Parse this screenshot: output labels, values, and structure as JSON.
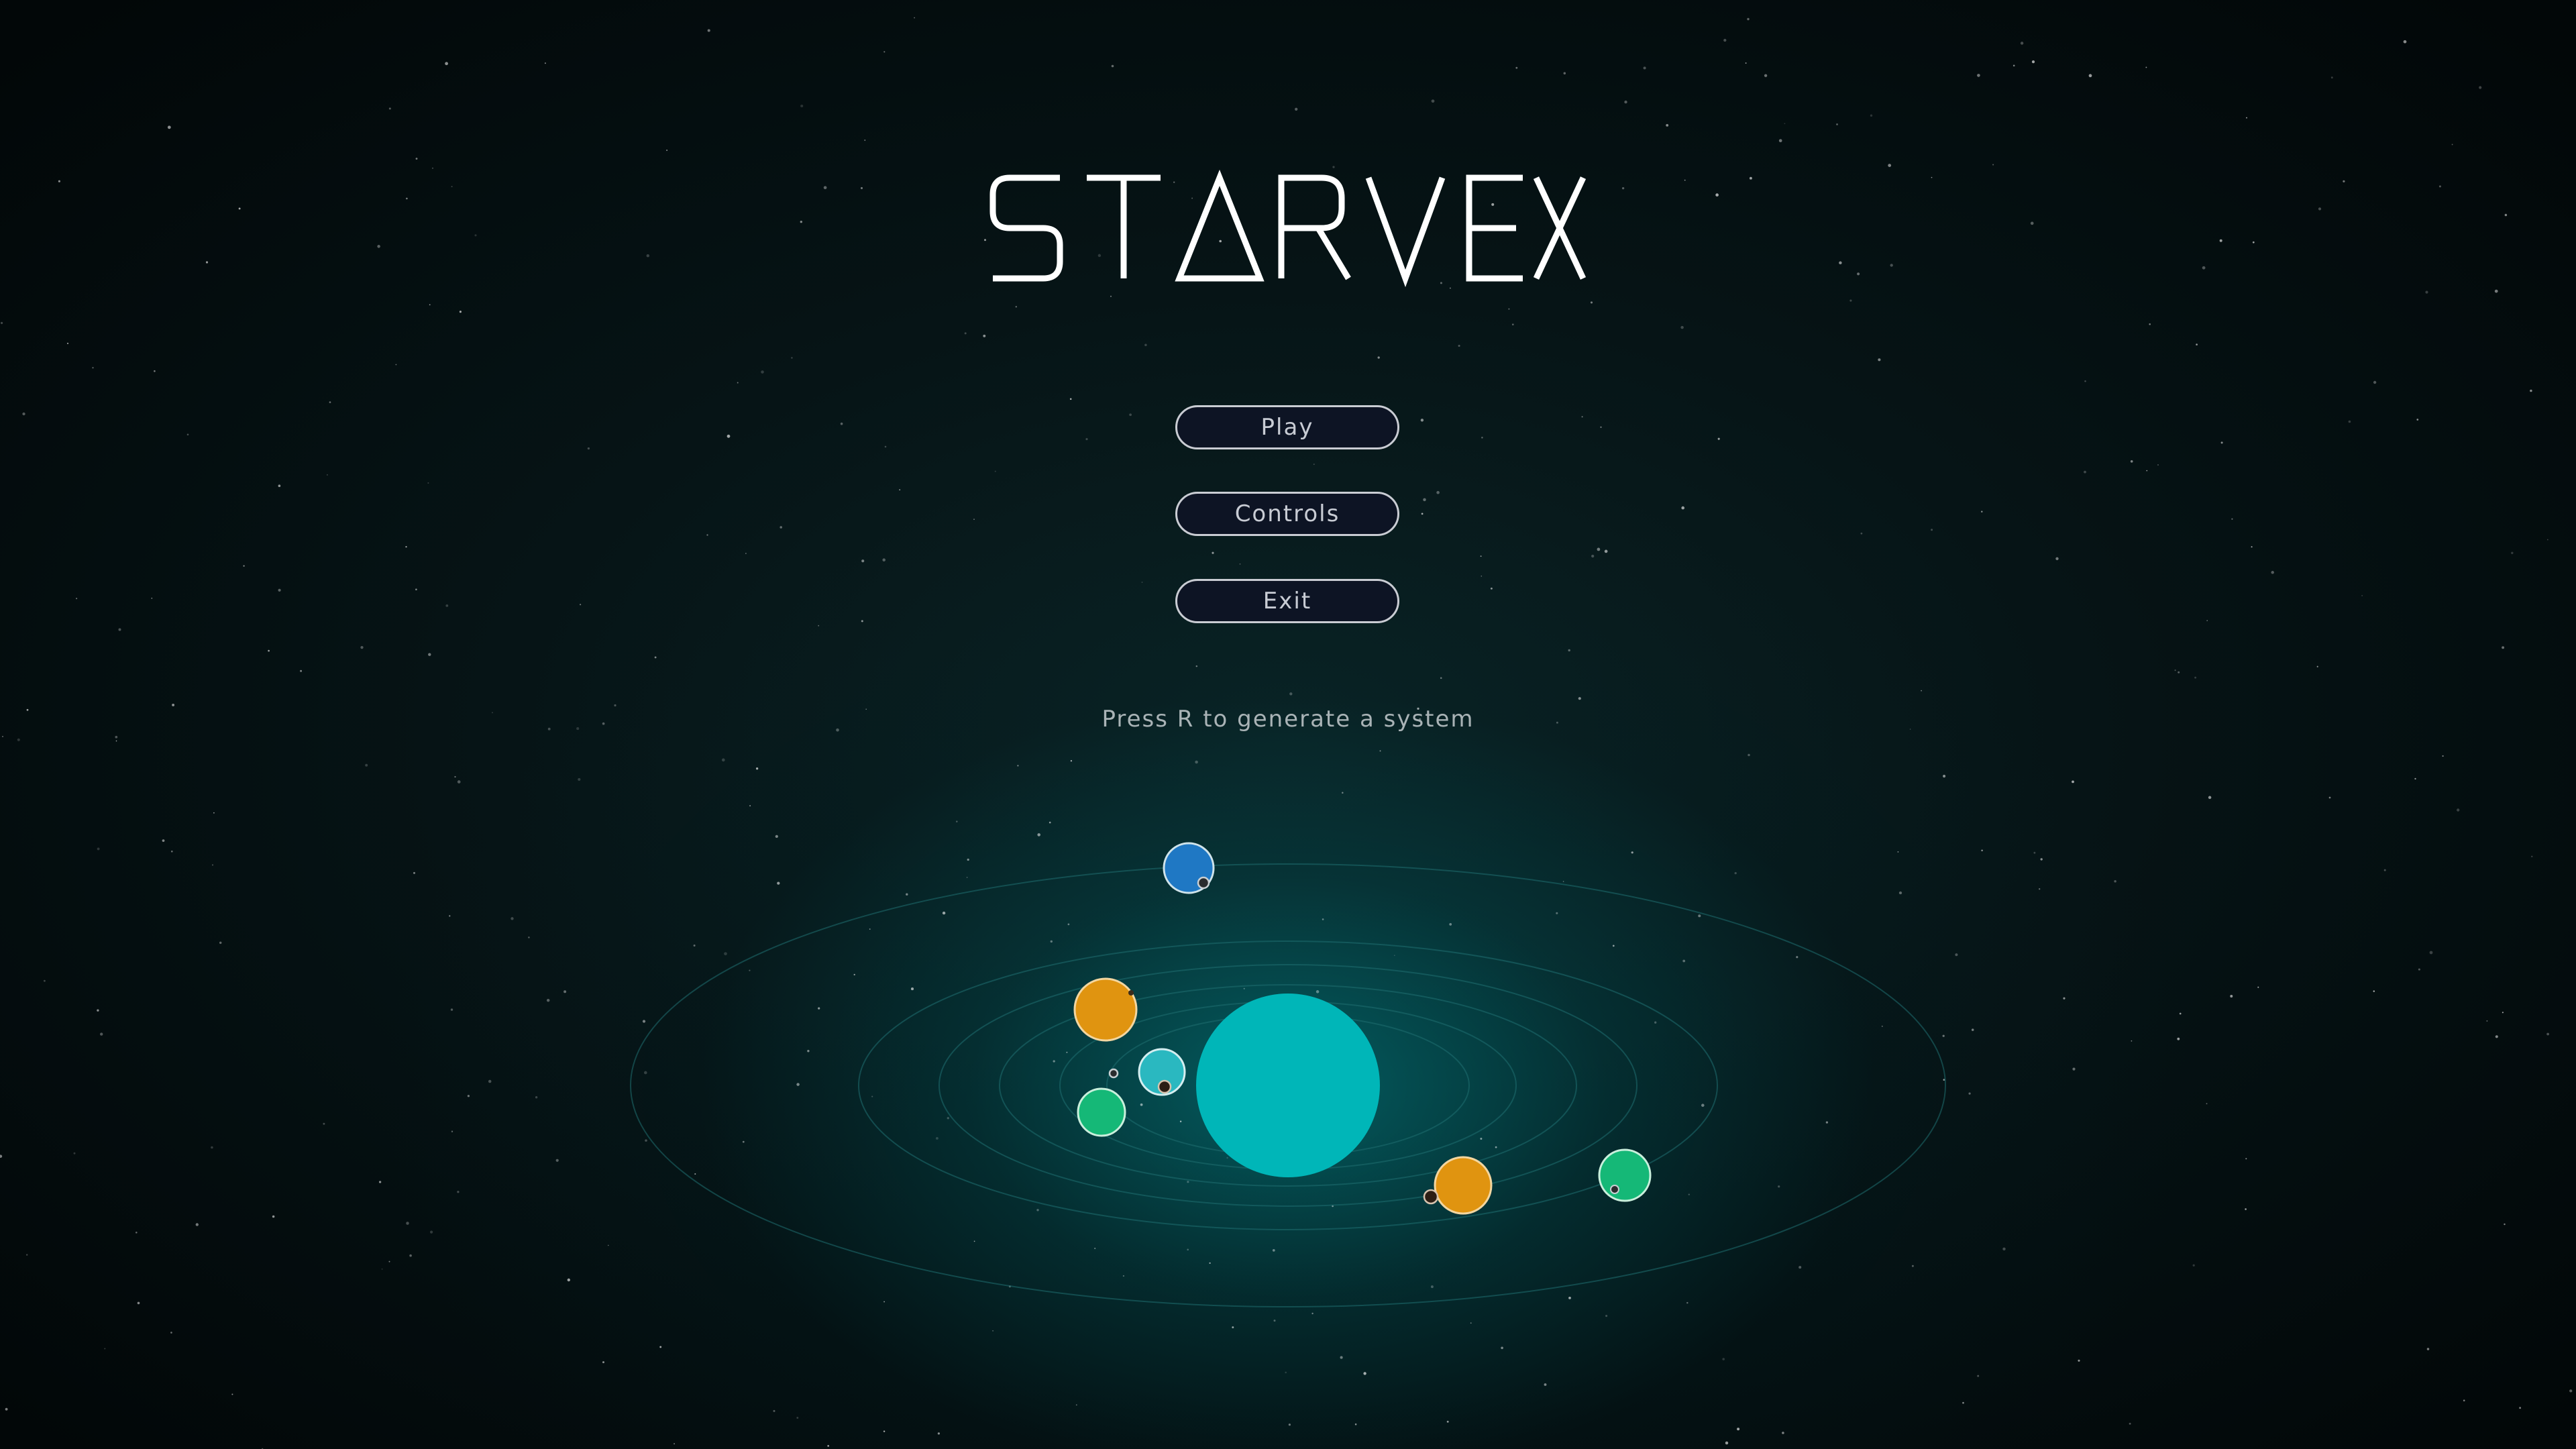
{
  "title": "STARVEX",
  "menu": {
    "play_label": "Play",
    "controls_label": "Controls",
    "exit_label": "Exit"
  },
  "hint": "Press R to generate a system",
  "colors": {
    "background": "#020708",
    "star": "#00b6b8",
    "orbit": "#1f6e70",
    "button_bg": "#0d1424",
    "button_border": "#c9ccd3",
    "text": "#c8ccd4"
  },
  "planets": [
    {
      "name": "blue-planet",
      "color": "#1f78c4",
      "has_moon": true
    },
    {
      "name": "orange-planet",
      "color": "#e09410",
      "has_moon": true
    },
    {
      "name": "cyan-planet",
      "color": "#2ab8c0",
      "has_moon": true
    },
    {
      "name": "green-planet",
      "color": "#15b877",
      "has_moon": false
    },
    {
      "name": "orange-planet",
      "color": "#e09410",
      "has_moon": true
    },
    {
      "name": "green-planet",
      "color": "#15b877",
      "has_moon": true
    }
  ]
}
